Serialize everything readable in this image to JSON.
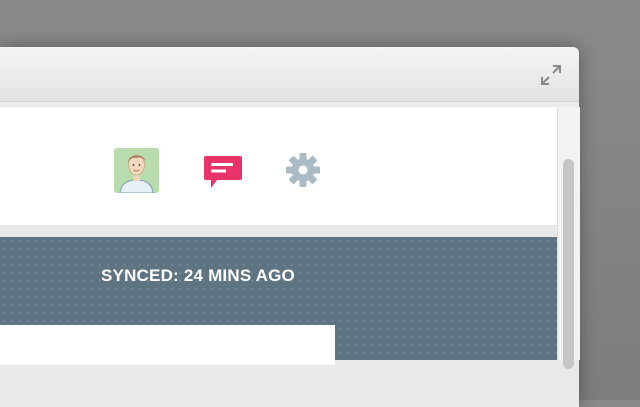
{
  "browser": {
    "icons": {
      "fullscreen": "fullscreen-expand-icon",
      "bookmark": "star-outline-icon",
      "extension": "green-circle-icon",
      "menu": "hamburger-menu-icon"
    },
    "extension_color": "#4fd811"
  },
  "app": {
    "header": {
      "avatar": "user-avatar",
      "messages_icon": "chat-bubble-icon",
      "settings_icon": "gear-icon",
      "accent_color": "#e8336b",
      "gear_color": "#a9bcc6"
    },
    "status": {
      "synced_text": "SYNCED: 24 MINS AGO"
    },
    "content_bg": "#5f7483"
  }
}
